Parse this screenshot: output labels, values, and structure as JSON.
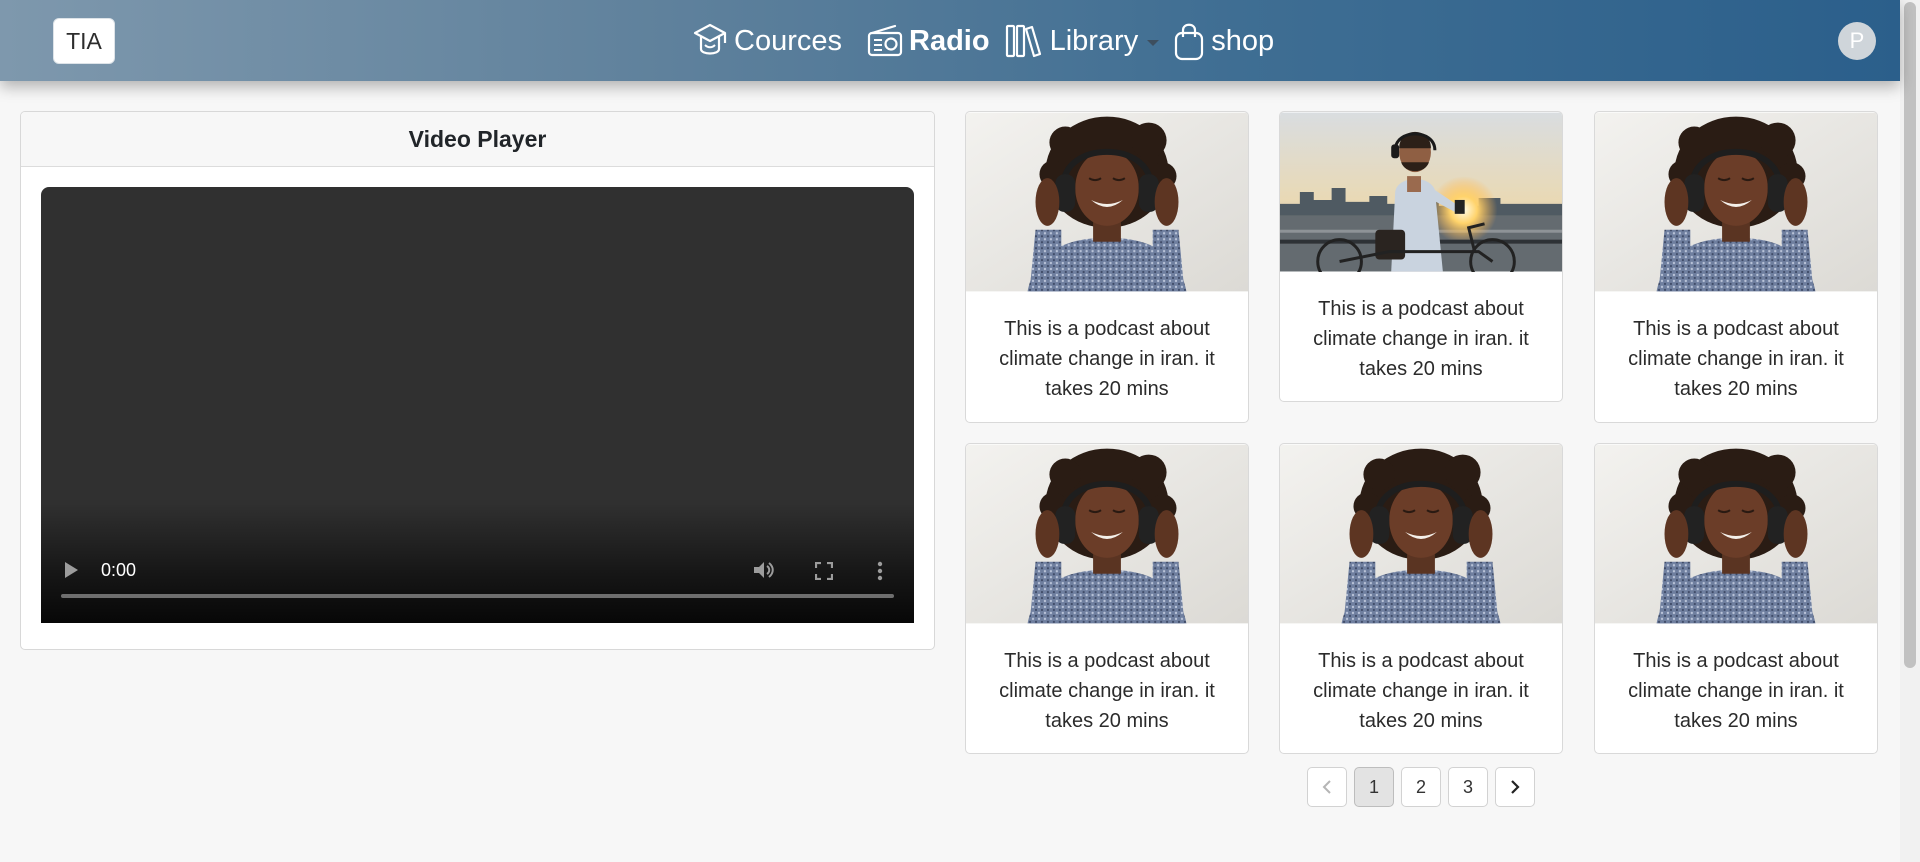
{
  "navbar": {
    "brand": "TIA",
    "links": [
      {
        "label": "Cources",
        "icon": "graduation-cap-icon"
      },
      {
        "label": "Radio",
        "icon": "radio-icon",
        "active": true
      },
      {
        "label": "Library",
        "icon": "books-icon",
        "dropdown": true
      },
      {
        "label": "shop",
        "icon": "shopping-bag-icon"
      }
    ],
    "avatar_initial": "P"
  },
  "video_player": {
    "title": "Video Player",
    "time": "0:00",
    "progress": 0
  },
  "podcasts": [
    {
      "description": "This is a podcast about climate change in iran. it takes 20 mins",
      "image": "woman-with-headphones"
    },
    {
      "description": "This is a podcast about climate change in iran. it takes 20 mins",
      "image": "man-with-bicycle-and-phone"
    },
    {
      "description": "This is a podcast about climate change in iran. it takes 20 mins",
      "image": "woman-with-headphones"
    },
    {
      "description": "This is a podcast about climate change in iran. it takes 20 mins",
      "image": "woman-with-headphones"
    },
    {
      "description": "This is a podcast about climate change in iran. it takes 20 mins",
      "image": "woman-with-headphones"
    },
    {
      "description": "This is a podcast about climate change in iran. it takes 20 mins",
      "image": "woman-with-headphones"
    }
  ],
  "pagination": {
    "pages": [
      "1",
      "2",
      "3"
    ],
    "current": "1"
  },
  "colors": {
    "navbar_start": "#7e98ad",
    "navbar_end": "#2b5f8b",
    "page_background": "#f7f7f7"
  }
}
